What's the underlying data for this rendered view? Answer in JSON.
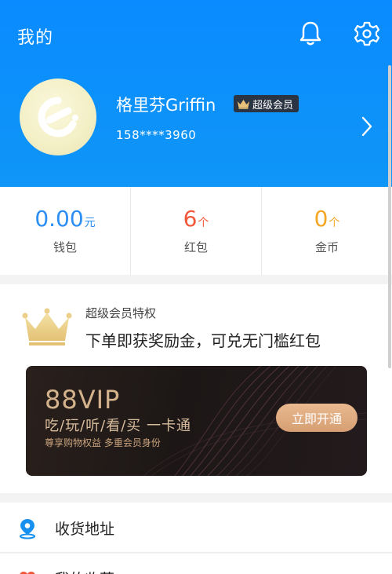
{
  "header": {
    "title": "我的",
    "bell_icon": "bell-icon",
    "settings_icon": "gear-icon",
    "background": "#0a8bff"
  },
  "profile": {
    "avatar_icon": "eleme-logo-avatar",
    "username": "格里芬Griffin",
    "badge": "超级会员",
    "phone": "158****3960",
    "arrow_icon": "chevron-right-icon"
  },
  "stats": [
    {
      "value": "0.00",
      "unit": "元",
      "label": "钱包",
      "color": "#2a8ef5"
    },
    {
      "value": "6",
      "unit": "个",
      "label": "红包",
      "color": "#f2573a"
    },
    {
      "value": "0",
      "unit": "个",
      "label": "金币",
      "color": "#f5a623"
    }
  ],
  "vip": {
    "subtitle": "超级会员特权",
    "headline": "下单即获奖励金，可兑无门槛红包",
    "banner": {
      "big": "88VIP",
      "mid": "吃/玩/听/看/买  一卡通",
      "small": "尊享购物权益 多重会员身份",
      "button": "立即开通"
    }
  },
  "list": [
    {
      "icon": "location-pin-icon",
      "label": "收货地址"
    },
    {
      "icon": "heart-icon",
      "label": "我的收藏"
    }
  ]
}
